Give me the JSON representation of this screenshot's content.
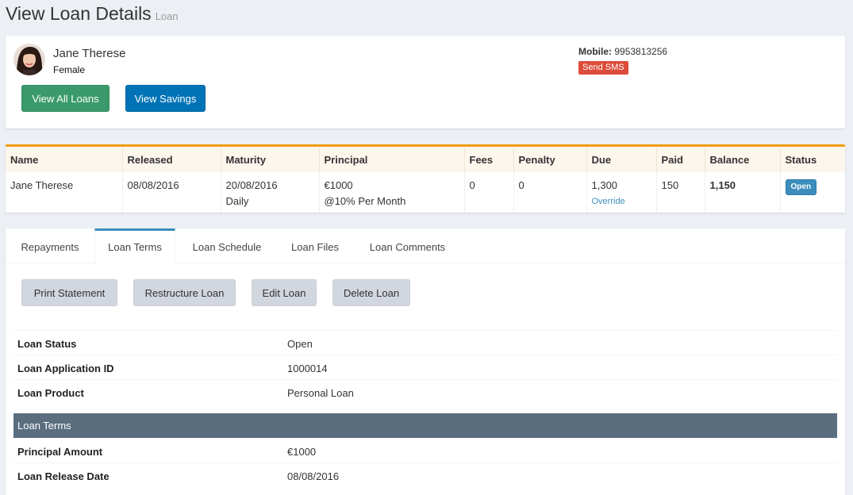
{
  "header": {
    "title": "View Loan Details",
    "subtitle": "Loan"
  },
  "borrower": {
    "name": "Jane Therese",
    "gender": "Female",
    "mobile_label": "Mobile:",
    "mobile_value": "9953813256",
    "send_sms_label": "Send SMS",
    "view_all_loans_label": "View All Loans",
    "view_savings_label": "View Savings"
  },
  "summary": {
    "columns": [
      "Name",
      "Released",
      "Maturity",
      "Principal",
      "Fees",
      "Penalty",
      "Due",
      "Paid",
      "Balance",
      "Status"
    ],
    "row": {
      "name": "Jane Therese",
      "released": "08/08/2016",
      "maturity": "20/08/2016",
      "maturity_freq": "Daily",
      "principal": "€1000",
      "interest": "@10% Per Month",
      "fees": "0",
      "penalty": "0",
      "due": "1,300",
      "override_label": "Override",
      "paid": "150",
      "balance": "1,150",
      "status": "Open"
    }
  },
  "tabs": [
    {
      "label": "Repayments",
      "active": false
    },
    {
      "label": "Loan Terms",
      "active": true
    },
    {
      "label": "Loan Schedule",
      "active": false
    },
    {
      "label": "Loan Files",
      "active": false
    },
    {
      "label": "Loan Comments",
      "active": false
    }
  ],
  "actions": {
    "print_statement": "Print Statement",
    "restructure_loan": "Restructure Loan",
    "edit_loan": "Edit Loan",
    "delete_loan": "Delete Loan"
  },
  "details": [
    {
      "label": "Loan Status",
      "value": "Open"
    },
    {
      "label": "Loan Application ID",
      "value": "1000014"
    },
    {
      "label": "Loan Product",
      "value": "Personal Loan"
    }
  ],
  "loan_terms_header": "Loan Terms",
  "terms": [
    {
      "label": "Principal Amount",
      "value": "€1000"
    },
    {
      "label": "Loan Release Date",
      "value": "08/08/2016"
    }
  ],
  "colors": {
    "accent": "#3c8dbc",
    "warning_border": "#f39c12",
    "danger": "#dd4b39",
    "success": "#3a9a6b",
    "primary": "#0073b7",
    "section_bar": "#5a6e80"
  }
}
